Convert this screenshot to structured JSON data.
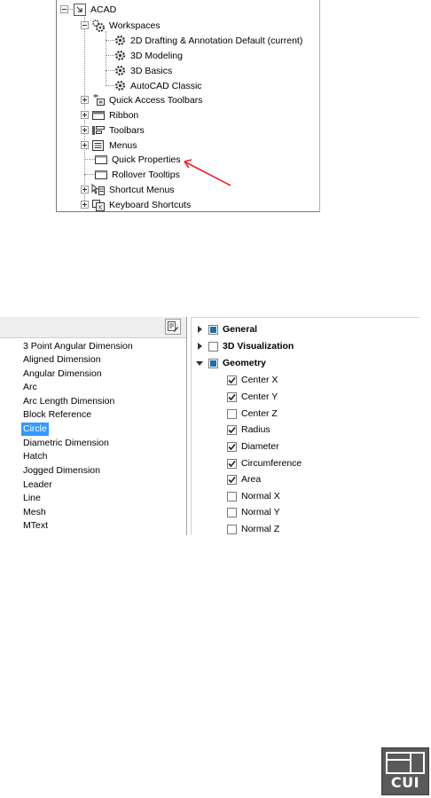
{
  "tree": {
    "root": "ACAD",
    "workspaces": {
      "label": "Workspaces",
      "items": [
        "2D Drafting & Annotation Default (current)",
        "3D Modeling",
        "3D Basics",
        "AutoCAD Classic"
      ]
    },
    "nodes": [
      {
        "label": "Quick Access Toolbars",
        "expandable": true,
        "icon": "quick-access-toolbar-icon"
      },
      {
        "label": "Ribbon",
        "expandable": true,
        "icon": "ribbon-icon"
      },
      {
        "label": "Toolbars",
        "expandable": true,
        "icon": "toolbars-icon"
      },
      {
        "label": "Menus",
        "expandable": true,
        "icon": "menus-icon"
      },
      {
        "label": "Quick Properties",
        "expandable": false,
        "icon": "quick-properties-icon"
      },
      {
        "label": "Rollover Tooltips",
        "expandable": false,
        "icon": "rollover-tooltips-icon"
      },
      {
        "label": "Shortcut Menus",
        "expandable": true,
        "icon": "shortcut-menus-icon"
      },
      {
        "label": "Keyboard Shortcuts",
        "expandable": true,
        "icon": "keyboard-shortcuts-icon"
      }
    ],
    "annotation_color": "#e8202a"
  },
  "object_types": {
    "items": [
      "3 Point Angular Dimension",
      "Aligned Dimension",
      "Angular Dimension",
      "Arc",
      "Arc Length Dimension",
      "Block Reference",
      "Circle",
      "Diametric Dimension",
      "Hatch",
      "Jogged Dimension",
      "Leader",
      "Line",
      "Mesh",
      "MText"
    ],
    "selected": "Circle",
    "selection_color": "#3399ff"
  },
  "properties": {
    "categories": [
      {
        "label": "General",
        "expanded": false,
        "checked": true
      },
      {
        "label": "3D Visualization",
        "expanded": false,
        "checked": false
      },
      {
        "label": "Geometry",
        "expanded": true,
        "checked": true
      }
    ],
    "geometry": [
      {
        "label": "Center X",
        "checked": true
      },
      {
        "label": "Center Y",
        "checked": true
      },
      {
        "label": "Center Z",
        "checked": false
      },
      {
        "label": "Radius",
        "checked": true
      },
      {
        "label": "Diameter",
        "checked": true
      },
      {
        "label": "Circumference",
        "checked": true
      },
      {
        "label": "Area",
        "checked": true
      },
      {
        "label": "Normal X",
        "checked": false
      },
      {
        "label": "Normal Y",
        "checked": false
      },
      {
        "label": "Normal Z",
        "checked": false
      }
    ]
  },
  "cui_icon": {
    "text": "CUI"
  }
}
